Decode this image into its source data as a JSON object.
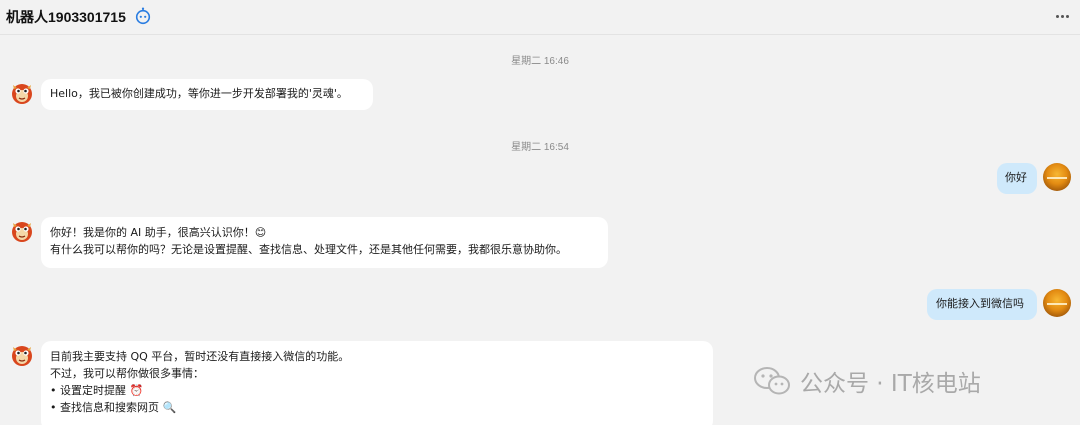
{
  "header": {
    "title": "机器人1903301715",
    "badge_icon": "robot-icon",
    "more_icon": "more-horizontal-icon"
  },
  "chat": {
    "messages": [
      {
        "type": "time",
        "text": "星期二 16:46"
      },
      {
        "type": "bot",
        "lines": [
          "Hello，我已被你创建成功，等你进一步开发部署我的'灵魂'。"
        ]
      },
      {
        "type": "time",
        "text": "星期二 16:54"
      },
      {
        "type": "user",
        "text": "你好"
      },
      {
        "type": "bot",
        "lines": [
          "你好！我是你的 AI 助手，很高兴认识你！😊",
          "有什么我可以帮你的吗？无论是设置提醒、查找信息、处理文件，还是其他任何需要，我都很乐意协助你。"
        ]
      },
      {
        "type": "user",
        "text": "你能接入到微信吗"
      },
      {
        "type": "bot",
        "lines": [
          "目前我主要支持 QQ 平台，暂时还没有直接接入微信的功能。",
          "不过，我可以帮你做很多事情：",
          "设置定时提醒 ⏰",
          "查找信息和搜索网页 🔍"
        ]
      }
    ]
  },
  "watermark": {
    "text": "公众号 · IT核电站",
    "icon": "wechat-icon"
  },
  "colors": {
    "background": "#f2f2f2",
    "bot_bubble": "#ffffff",
    "user_bubble": "#cfe9fb",
    "timestamp": "#8a8a8a"
  }
}
